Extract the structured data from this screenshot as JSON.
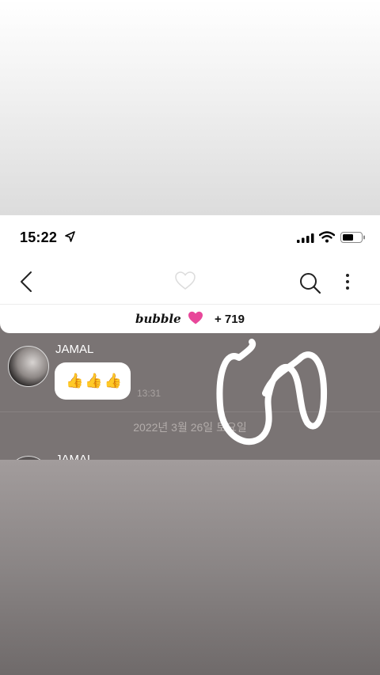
{
  "status_bar": {
    "time": "15:22"
  },
  "banner": {
    "brand": "bubble",
    "count": "+ 719"
  },
  "messages": [
    {
      "sender": "JAMAL",
      "content": "👍👍👍",
      "time": "13:31"
    }
  ],
  "date_separator": "2022년 3월 26일 토요일",
  "next_sender": "JAMAL",
  "colors": {
    "accent_pink": "#e8479a",
    "chat_bg": "#7a7474"
  },
  "icons": [
    "location-arrow-icon",
    "cellular-signal-icon",
    "wifi-icon",
    "battery-icon",
    "back-arrow-icon",
    "heart-icon",
    "search-icon",
    "more-options-icon",
    "heart-pink-icon"
  ]
}
